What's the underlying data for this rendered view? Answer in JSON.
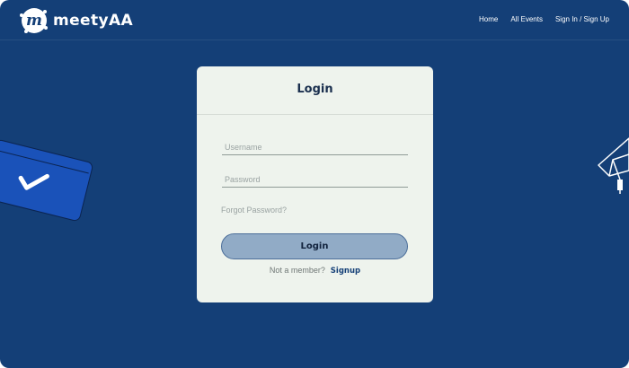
{
  "brand": {
    "logo_letter": "m",
    "name": "meetyAA"
  },
  "nav": {
    "items": [
      {
        "label": "Home"
      },
      {
        "label": "All Events"
      },
      {
        "label": "Sign In / Sign Up"
      }
    ]
  },
  "login_card": {
    "title": "Login",
    "username": {
      "value": "",
      "placeholder": "Username"
    },
    "password": {
      "value": "",
      "placeholder": "Password"
    },
    "forgot_password": "Forgot Password?",
    "login_button": "Login",
    "not_member_text": "Not a member?",
    "signup_link": "Signup"
  },
  "colors": {
    "background": "#143f77",
    "card": "#eef3ed",
    "button": "#91abc6",
    "accent_card": "#1a52b9"
  }
}
